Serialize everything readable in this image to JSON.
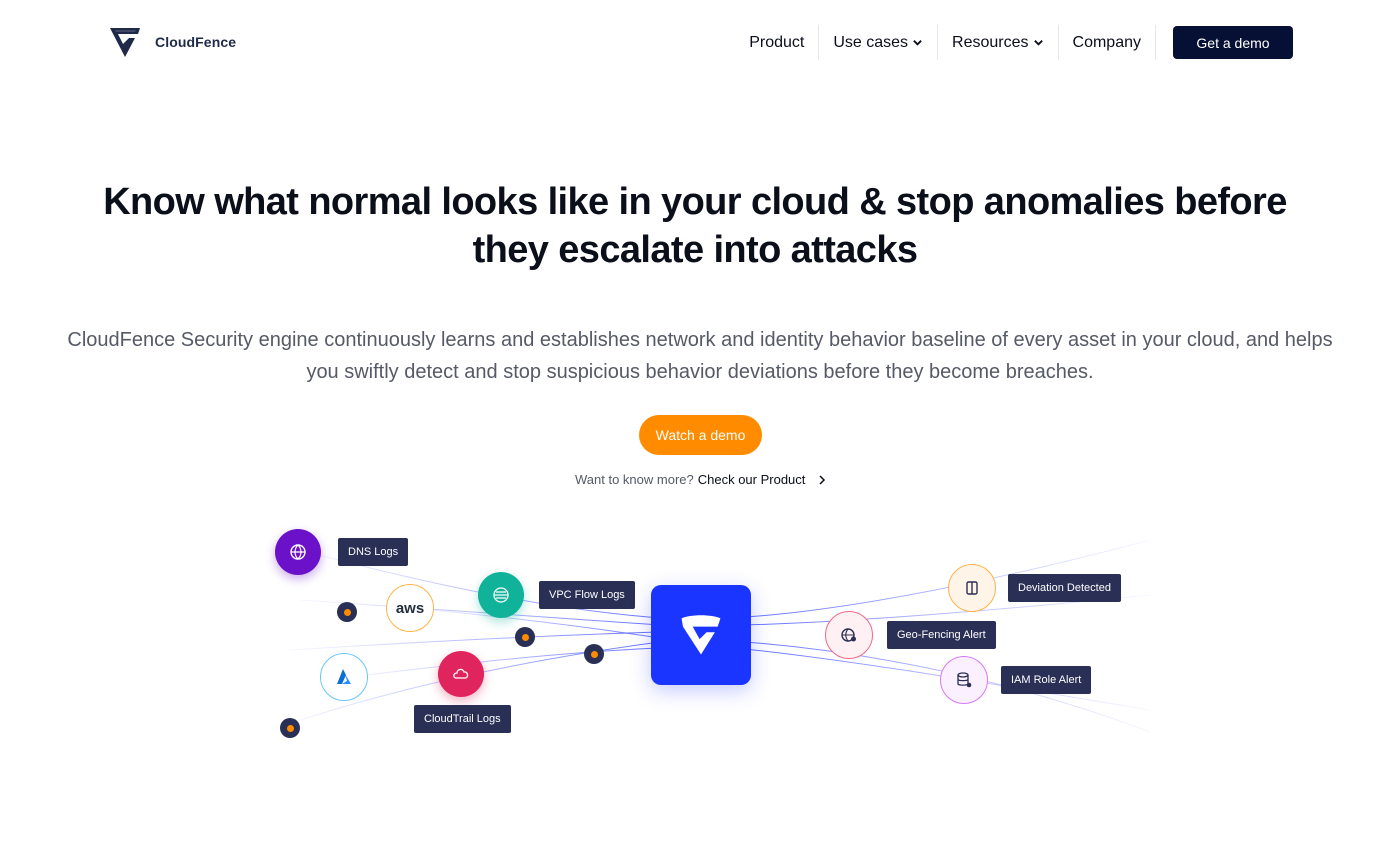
{
  "header": {
    "brand": "CloudFence",
    "nav": [
      {
        "label": "Product",
        "has_dropdown": false
      },
      {
        "label": "Use cases",
        "has_dropdown": true
      },
      {
        "label": "Resources",
        "has_dropdown": true
      },
      {
        "label": "Company",
        "has_dropdown": false
      }
    ],
    "cta": "Get a demo"
  },
  "hero": {
    "headline_line1": "Know what normal looks like in your cloud & stop anomalies before",
    "headline_line2": "they escalate into attacks",
    "sub_line1": "CloudFence Security engine continuously learns and establishes network and identity behavior baseline of every asset in your cloud,  and helps",
    "sub_line2": "you swiftly detect and stop suspicious behavior deviations before they become breaches.",
    "watch_button": "Watch a demo",
    "more_question": "Want to know more?",
    "more_link": "Check our Product"
  },
  "illustration": {
    "sources": {
      "dns": "DNS Logs",
      "vpc": "VPC Flow Logs",
      "aws": "aws",
      "cloudtrail": "CloudTrail Logs"
    },
    "alerts": {
      "deviation": "Deviation Detected",
      "geofence": "Geo-Fencing Alert",
      "iam": "IAM Role Alert"
    }
  },
  "colors": {
    "primary_dark": "#061034",
    "accent_orange": "#ff8c00",
    "hub_blue": "#1a35ff",
    "tag_bg": "#2a2f55"
  }
}
